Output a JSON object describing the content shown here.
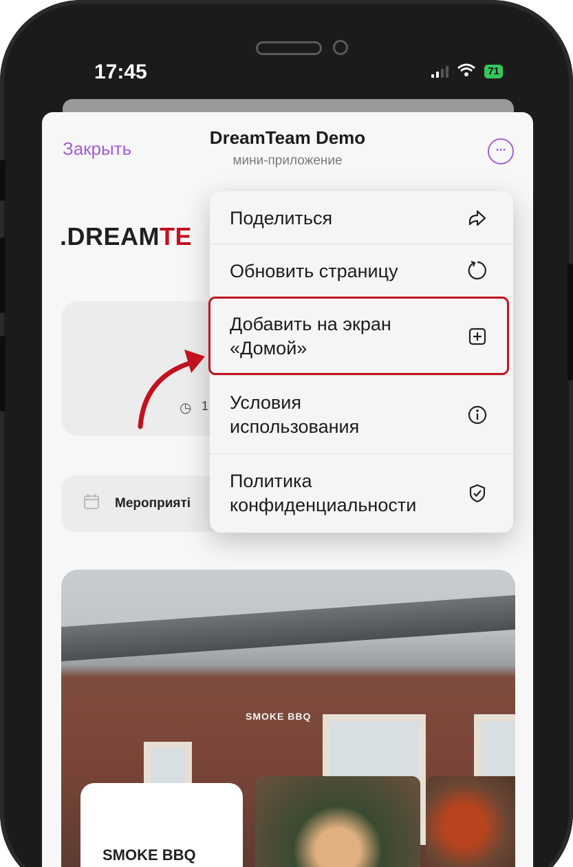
{
  "status_bar": {
    "time": "17:45",
    "battery": "71"
  },
  "header": {
    "close_label": "Закрыть",
    "title": "DreamTeam Demo",
    "subtitle": "мини-приложение",
    "more_glyph": "···"
  },
  "page": {
    "logo_main": ".DREAM",
    "logo_accent": "TE",
    "clock_text": "1",
    "events_label": "Мероприяті",
    "photo_sign": "SMOKE BBQ",
    "brand_name": "SMOKE BBQ"
  },
  "menu": {
    "items": [
      {
        "label": "Поделиться",
        "icon": "share-icon"
      },
      {
        "label": "Обновить страницу",
        "icon": "refresh-icon"
      },
      {
        "label": "Добавить на экран «Домой»",
        "icon": "add-square-icon"
      },
      {
        "label": "Условия использования",
        "icon": "info-icon"
      },
      {
        "label": "Политика конфиденциальности",
        "icon": "shield-check-icon"
      }
    ]
  },
  "colors": {
    "accent_purple": "#a35fd3",
    "highlight_red": "#c1121f",
    "battery_green": "#35c759"
  }
}
